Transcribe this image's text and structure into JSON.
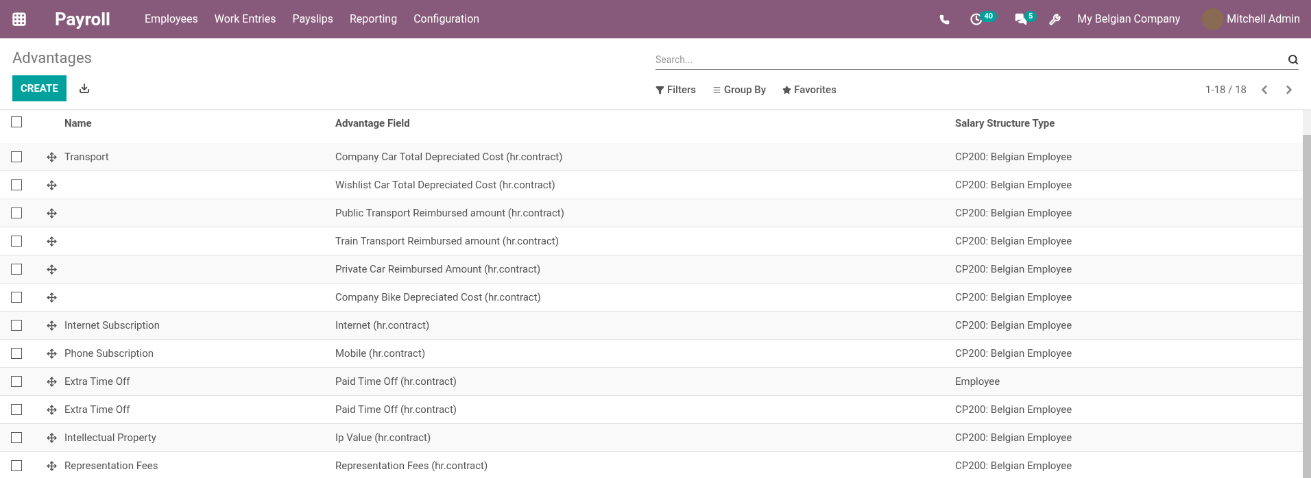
{
  "navbar": {
    "app_title": "Payroll",
    "menu": [
      "Employees",
      "Work Entries",
      "Payslips",
      "Reporting",
      "Configuration"
    ],
    "activity_count": "40",
    "message_count": "5",
    "company": "My Belgian Company",
    "user": "Mitchell Admin"
  },
  "page": {
    "title": "Advantages",
    "create_label": "CREATE",
    "search": {
      "placeholder": "Search..."
    },
    "filters": [
      "Filters",
      "Group By",
      "Favorites"
    ],
    "pager": "1-18 / 18"
  },
  "table": {
    "all_checked": false,
    "columns": [
      "Name",
      "Advantage Field",
      "Salary Structure Type"
    ],
    "rows": [
      {
        "checked": false,
        "name": "Transport",
        "field": "Company Car Total Depreciated Cost (hr.contract)",
        "structure": "CP200: Belgian Employee"
      },
      {
        "checked": false,
        "name": "",
        "field": "Wishlist Car Total Depreciated Cost (hr.contract)",
        "structure": "CP200: Belgian Employee"
      },
      {
        "checked": false,
        "name": "",
        "field": "Public Transport Reimbursed amount (hr.contract)",
        "structure": "CP200: Belgian Employee"
      },
      {
        "checked": false,
        "name": "",
        "field": "Train Transport Reimbursed amount (hr.contract)",
        "structure": "CP200: Belgian Employee"
      },
      {
        "checked": false,
        "name": "",
        "field": "Private Car Reimbursed Amount (hr.contract)",
        "structure": "CP200: Belgian Employee"
      },
      {
        "checked": false,
        "name": "",
        "field": "Company Bike Depreciated Cost (hr.contract)",
        "structure": "CP200: Belgian Employee"
      },
      {
        "checked": false,
        "name": "Internet Subscription",
        "field": "Internet (hr.contract)",
        "structure": "CP200: Belgian Employee"
      },
      {
        "checked": false,
        "name": "Phone Subscription",
        "field": "Mobile (hr.contract)",
        "structure": "CP200: Belgian Employee"
      },
      {
        "checked": false,
        "name": "Extra Time Off",
        "field": "Paid Time Off (hr.contract)",
        "structure": "Employee"
      },
      {
        "checked": false,
        "name": "Extra Time Off",
        "field": "Paid Time Off (hr.contract)",
        "structure": "CP200: Belgian Employee"
      },
      {
        "checked": false,
        "name": "Intellectual Property",
        "field": "Ip Value (hr.contract)",
        "structure": "CP200: Belgian Employee"
      },
      {
        "checked": false,
        "name": "Representation Fees",
        "field": "Representation Fees (hr.contract)",
        "structure": "CP200: Belgian Employee"
      }
    ]
  }
}
